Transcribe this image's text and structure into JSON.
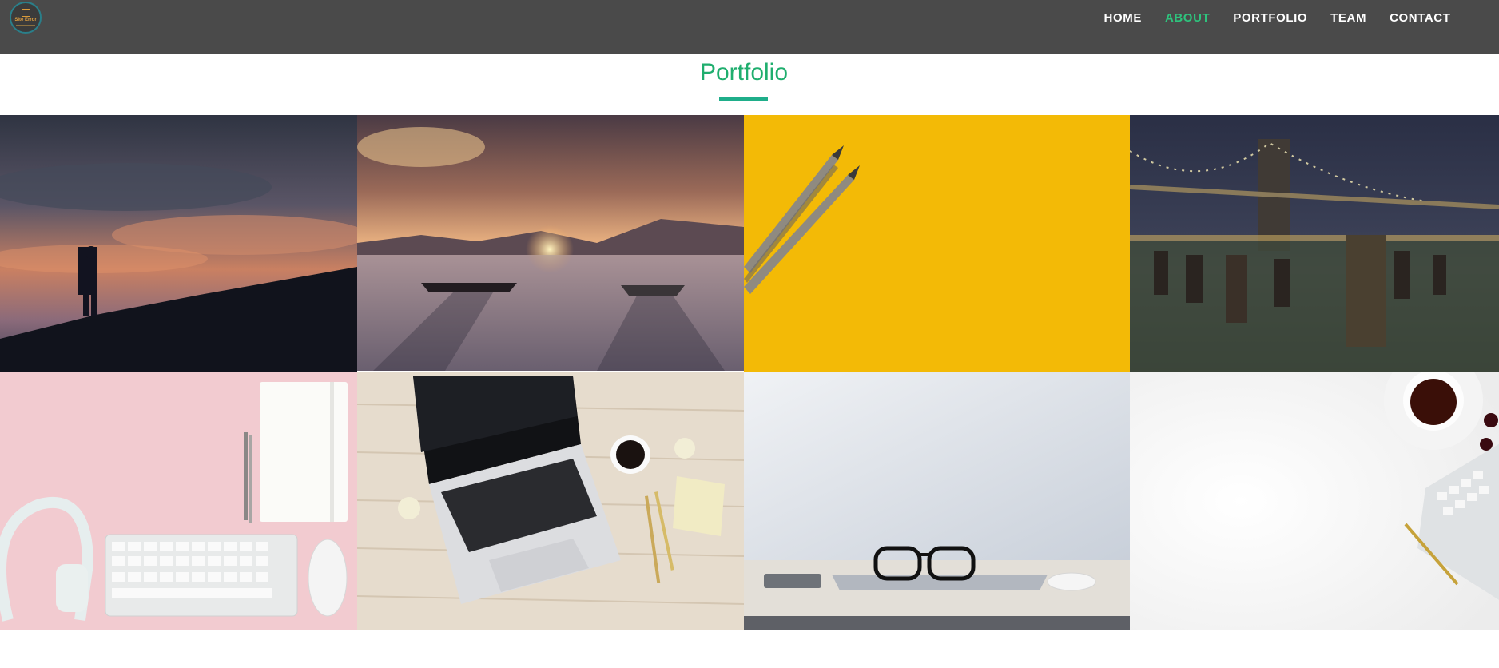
{
  "navbar": {
    "logo_text": "Site Error",
    "menu": [
      {
        "label": "HOME",
        "active": false
      },
      {
        "label": "ABOUT",
        "active": true
      },
      {
        "label": "PORTFOLIO",
        "active": false
      },
      {
        "label": "TEAM",
        "active": false
      },
      {
        "label": "CONTACT",
        "active": false
      }
    ]
  },
  "portfolio": {
    "title": "Portfolio",
    "items": [
      {
        "subject": "silhouette-at-sunset"
      },
      {
        "subject": "boats-on-frozen-lake"
      },
      {
        "subject": "pencils-on-yellow"
      },
      {
        "subject": "brooklyn-bridge-night"
      },
      {
        "subject": "pink-desk-keyboard-headphones"
      },
      {
        "subject": "laptop-on-wooden-desk"
      },
      {
        "subject": "glasses-on-laptop"
      },
      {
        "subject": "white-desk-coffee-keyboard"
      }
    ]
  },
  "colors": {
    "navbar_bg": "#4a4a4a",
    "accent_green": "#2ec37d",
    "title_green": "#1fae6e",
    "underline": "#1fae8a"
  }
}
